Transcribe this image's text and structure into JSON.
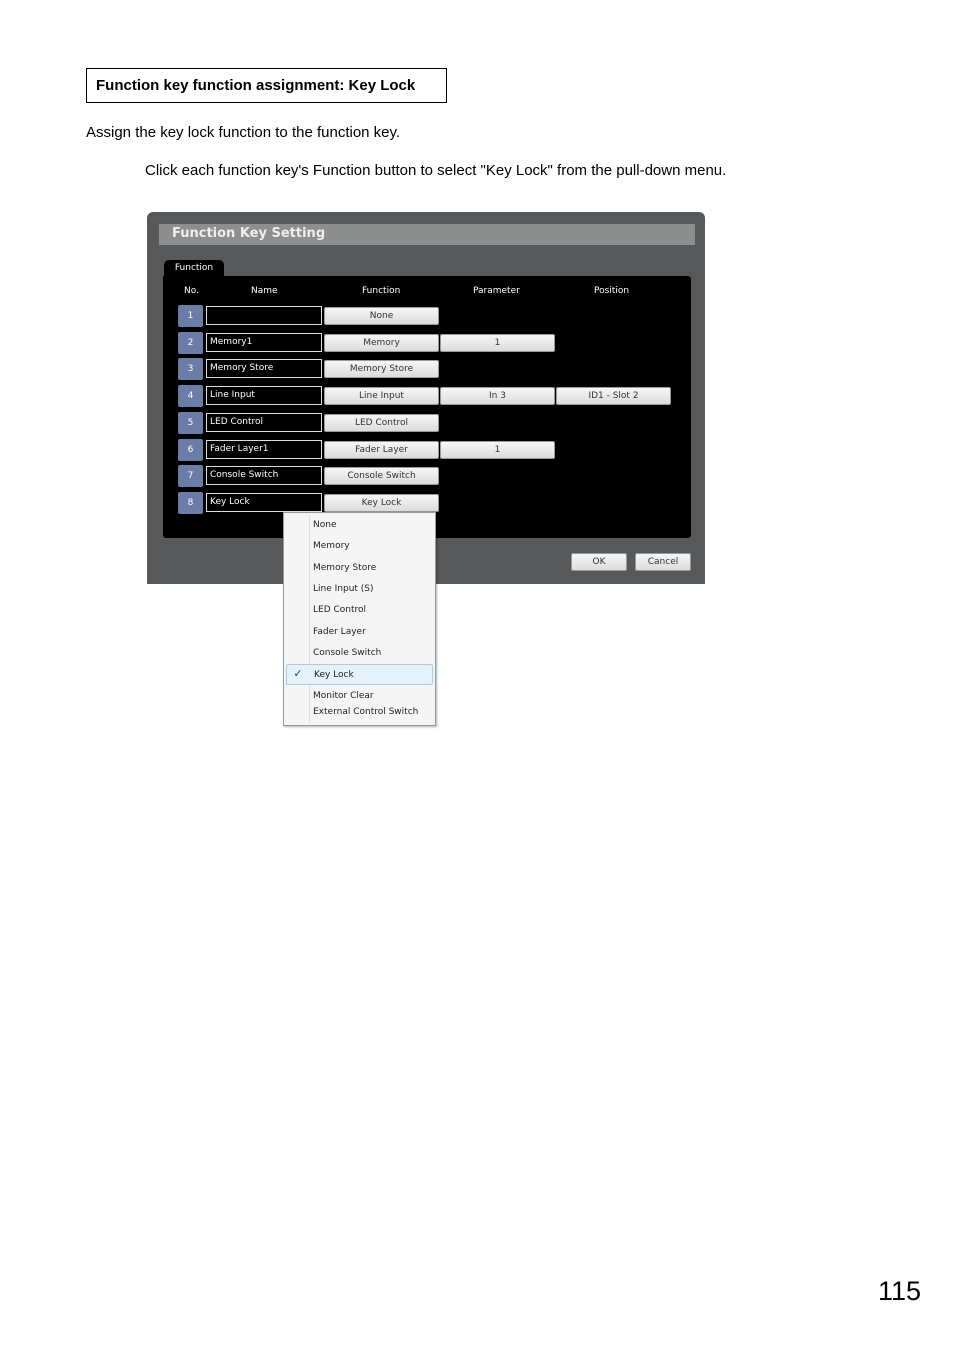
{
  "page": {
    "section_title": "Function key function assignment: Key Lock",
    "intro": "Assign the key lock function to the function key.",
    "instruction": "Click each function key's Function button to select \"Key Lock\" from the pull-down menu.",
    "page_number": "115"
  },
  "dialog": {
    "title": "Function Key Setting",
    "tab": "Function",
    "columns": {
      "no": "No.",
      "name": "Name",
      "function": "Function",
      "parameter": "Parameter",
      "position": "Position"
    },
    "rows": [
      {
        "no": "1",
        "name": "",
        "function": "None",
        "parameter": null,
        "position": null
      },
      {
        "no": "2",
        "name": "Memory1",
        "function": "Memory",
        "parameter": "1",
        "position": null
      },
      {
        "no": "3",
        "name": "Memory Store",
        "function": "Memory Store",
        "parameter": null,
        "position": null
      },
      {
        "no": "4",
        "name": "Line Input",
        "function": "Line Input",
        "parameter": "In 3",
        "position": "ID1 - Slot 2"
      },
      {
        "no": "5",
        "name": "LED Control",
        "function": "LED Control",
        "parameter": null,
        "position": null
      },
      {
        "no": "6",
        "name": "Fader Layer1",
        "function": "Fader Layer",
        "parameter": "1",
        "position": null
      },
      {
        "no": "7",
        "name": "Console Switch",
        "function": "Console Switch",
        "parameter": null,
        "position": null
      },
      {
        "no": "8",
        "name": "Key Lock",
        "function": "Key Lock",
        "parameter": null,
        "position": null
      }
    ],
    "ok_label": "OK",
    "cancel_label": "Cancel"
  },
  "menu": {
    "items": [
      {
        "label": "None"
      },
      {
        "label": "Memory"
      },
      {
        "label": "Memory Store"
      },
      {
        "label": "Line Input (S)"
      },
      {
        "label": "LED Control"
      },
      {
        "label": "Fader Layer"
      },
      {
        "label": "Console Switch"
      },
      {
        "label": "Key Lock",
        "selected": true,
        "check": "✓"
      },
      {
        "label": "Monitor Clear"
      },
      {
        "label": "External Control Switch"
      }
    ]
  }
}
